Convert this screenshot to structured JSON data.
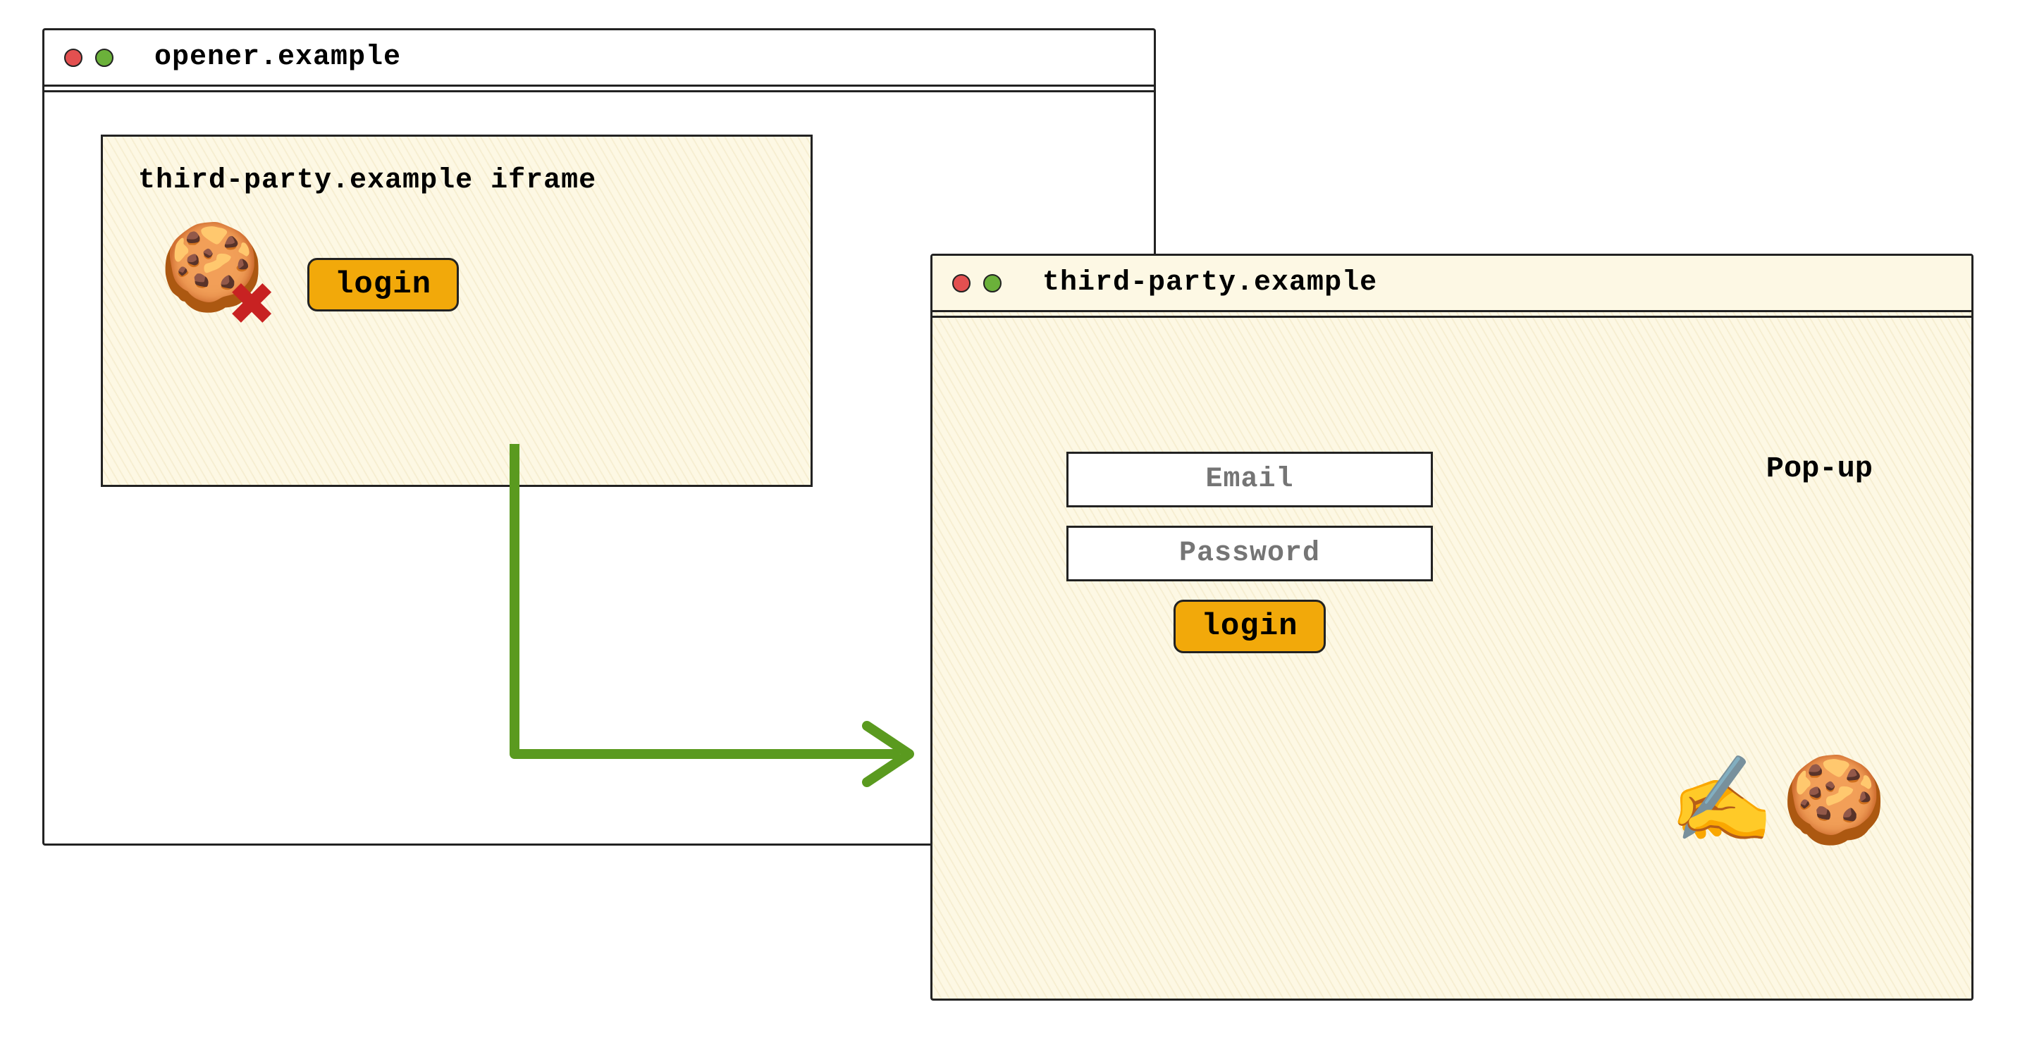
{
  "main_window": {
    "address": "opener.example",
    "iframe": {
      "label": "third-party.example iframe",
      "cookie_icon": "🍪",
      "blocked_icon": "✖",
      "login_button": "login"
    }
  },
  "popup_window": {
    "address": "third-party.example",
    "label": "Pop-up",
    "email_placeholder": "Email",
    "password_placeholder": "Password",
    "login_button": "login",
    "writing_icon": "✍️",
    "cookie_icon": "🍪"
  },
  "colors": {
    "red_dot": "#e35050",
    "green_dot": "#6bb13a",
    "button": "#f2a90a",
    "arrow": "#5a9a1f",
    "hatch_bg": "#fdf8e4"
  }
}
